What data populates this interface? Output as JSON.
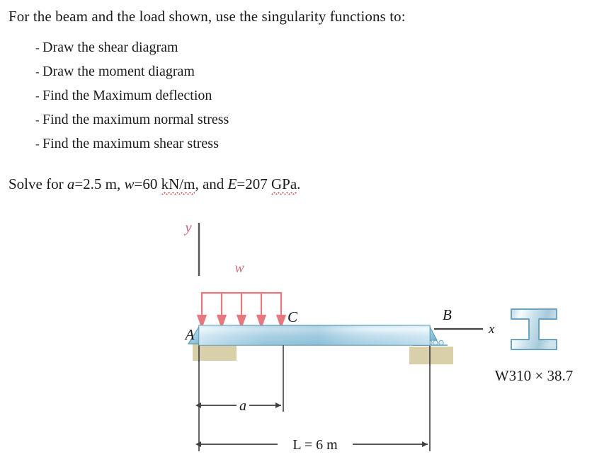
{
  "problem": {
    "prompt": "For the beam and the load shown, use the singularity functions to:",
    "tasks": [
      {
        "bullet": "-",
        "label": "Draw the shear diagram"
      },
      {
        "bullet": "-",
        "label": "Draw the moment diagram"
      },
      {
        "bullet": "-",
        "label": "Find the Maximum deflection"
      },
      {
        "bullet": "-",
        "label": "Find the maximum normal stress"
      },
      {
        "bullet": "-",
        "label": "Find the maximum shear stress"
      }
    ],
    "solve": {
      "lead": "Solve for ",
      "var_a": "a",
      "eq_a": "=2.5 m, ",
      "var_w": "w",
      "eq_w": "=60 ",
      "unit_w": "kN/m",
      "conj": ", and ",
      "var_e": "E",
      "eq_e": "=207 ",
      "unit_e": "GPa",
      "period": "."
    }
  },
  "figure": {
    "axis_y_label": "y",
    "axis_x_label": "x",
    "load_label": "w",
    "point_a": "A",
    "point_b": "B",
    "point_c": "C",
    "dim_a": "a",
    "dim_l": "L = 6 m",
    "section_label": "W310 × 38.7",
    "colors": {
      "load_arrow": "#e8787f",
      "beam_edge": "#5b9ab5",
      "beam_fill_light": "#f2f9fc",
      "beam_fill_mid": "#a9d3e6",
      "support_fill": "#d9cfa8",
      "support_triangle": "#8fc4dd",
      "dimension_line": "#4a4a4a",
      "section_fill": "#cfe2ec",
      "section_edge": "#6ba3c0"
    }
  }
}
